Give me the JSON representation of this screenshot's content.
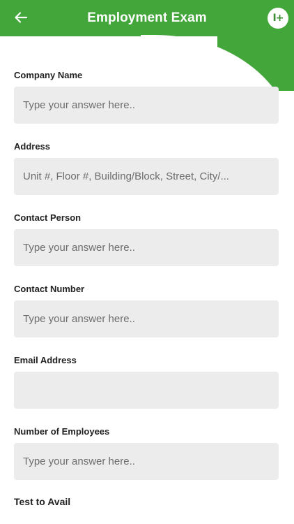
{
  "header": {
    "title": "Employment Exam",
    "back_icon": "arrow-left-icon",
    "logo_text": "I+",
    "accent_color": "#43a63b"
  },
  "form": {
    "fields": [
      {
        "label": "Company Name",
        "value": "",
        "placeholder": "Type your answer here.."
      },
      {
        "label": "Address",
        "value": "",
        "placeholder": "Unit #, Floor #, Building/Block, Street, City/..."
      },
      {
        "label": "Contact Person",
        "value": "",
        "placeholder": "Type your answer here.."
      },
      {
        "label": "Contact Number",
        "value": "",
        "placeholder": "Type your answer here.."
      },
      {
        "label": "Email Address",
        "value": "",
        "placeholder": ""
      },
      {
        "label": "Number of Employees",
        "value": "",
        "placeholder": "Type your answer here.."
      }
    ],
    "next_section": "Test to Avail"
  }
}
